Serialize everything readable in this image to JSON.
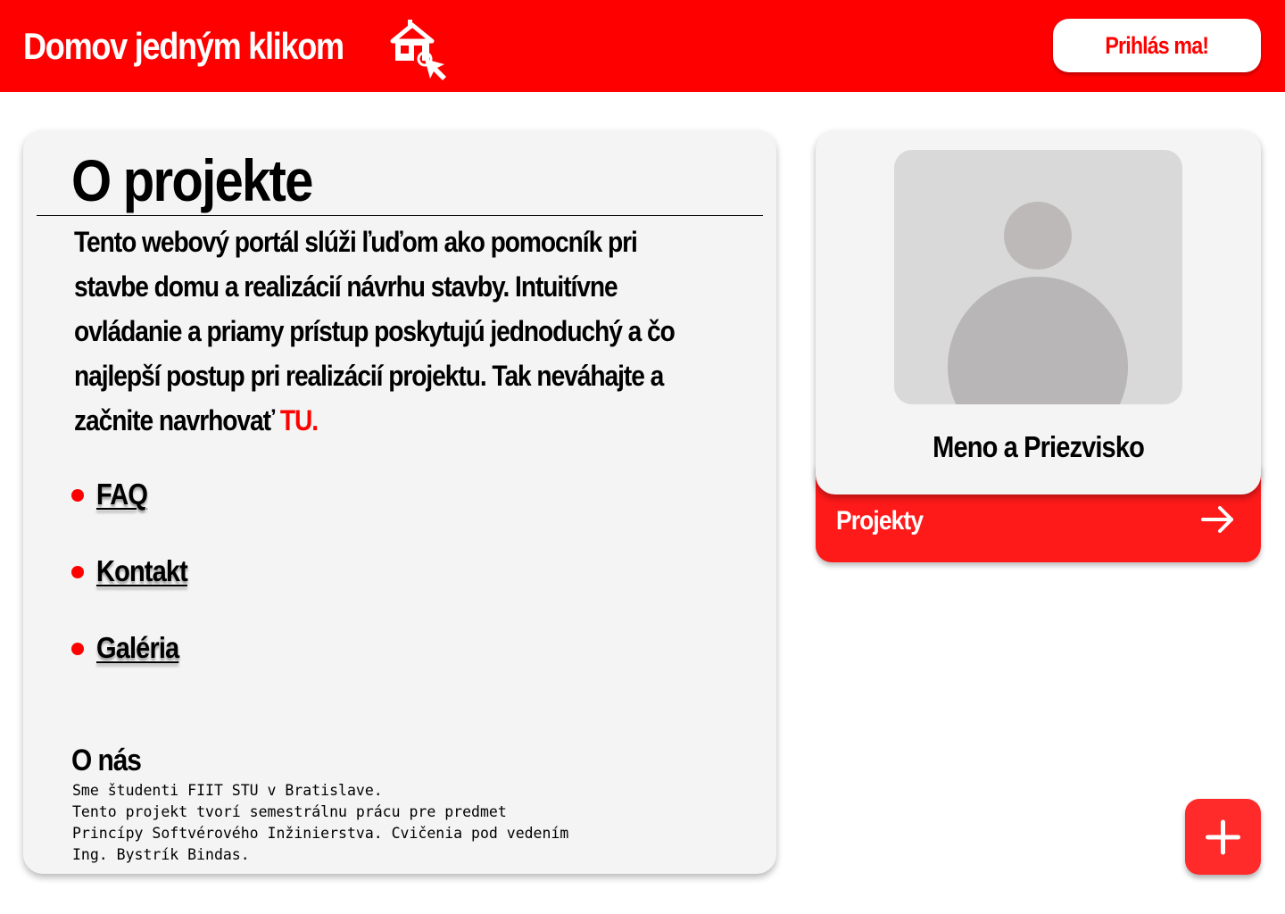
{
  "header": {
    "brand": "Domov jedným klikom",
    "brand_icon": "house-cursor-icon",
    "login_label": "Prihlás ma!",
    "colors": {
      "header_bg": "#ff0000",
      "accent": "#ff0000"
    }
  },
  "about": {
    "title": "O projekte",
    "text": "Tento webový portál slúži ľuďom ako pomocník pri stavbe domu a realizácií návrhu stavby. Intuitívne ovládanie a priamy prístup poskytujú jednoduchý a čo najlepší postup pri realizácií projektu. Tak neváhajte a začnite navrhovať",
    "link_label": "TU.",
    "links": [
      {
        "label": "FAQ"
      },
      {
        "label": "Kontakt"
      },
      {
        "label": "Galéria"
      }
    ],
    "onas_title": "O nás",
    "onas_text": "Sme študenti FIIT STU v Bratislave.\nTento projekt tvorí semestrálnu prácu pre predmet Princípy Softvérového Inžinierstva. Cvičenia pod vedením Ing. Bystrík Bindas."
  },
  "profile": {
    "avatar_icon": "user-avatar-icon",
    "name": "Meno a Priezvisko",
    "projects_label": "Projekty",
    "projects_icon": "arrow-right-icon"
  },
  "fab": {
    "icon": "plus-icon"
  }
}
